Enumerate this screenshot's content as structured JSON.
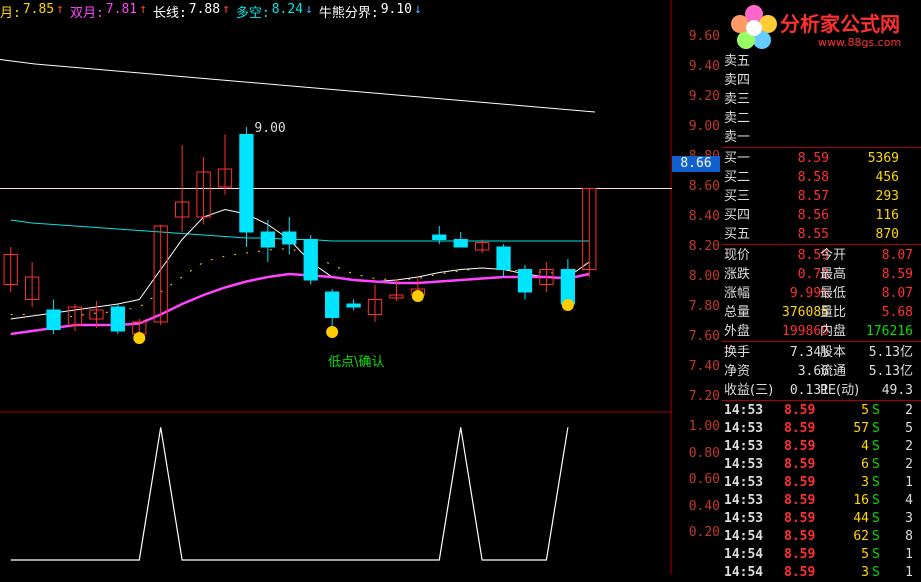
{
  "header": {
    "items": [
      {
        "label": "月:",
        "value": "7.85",
        "arrow": "↑",
        "color": "#ffd700"
      },
      {
        "label": "双月:",
        "value": "7.81",
        "arrow": "↑",
        "color": "#ff44ff"
      },
      {
        "label": "长线:",
        "value": "7.88",
        "arrow": "↑",
        "color": "#ffffff"
      },
      {
        "label": "多空:",
        "value": "8.24",
        "arrow": "↓",
        "color": "#00e5e5"
      },
      {
        "label": "牛熊分界:",
        "value": "9.10",
        "arrow": "↓",
        "color": "#ffffff"
      }
    ]
  },
  "price_marker": "8.66",
  "annotations": {
    "high_label": "9.00",
    "low_label": "低点\\确认"
  },
  "logo": {
    "title": "分析家公式网",
    "url": "www.88gs.com"
  },
  "chart_data": [
    {
      "type": "candlestick",
      "y_ticks_main": [
        "9.60",
        "9.40",
        "9.20",
        "9.00",
        "8.80",
        "8.60",
        "8.40",
        "8.20",
        "8.00",
        "7.80",
        "7.60",
        "7.40",
        "7.20"
      ],
      "ylim": [
        7.1,
        9.7
      ],
      "reference_line": 8.59,
      "candles": [
        {
          "o": 7.95,
          "h": 8.2,
          "l": 7.9,
          "c": 8.15
        },
        {
          "o": 7.85,
          "h": 8.1,
          "l": 7.8,
          "c": 8.0
        },
        {
          "o": 7.78,
          "h": 7.85,
          "l": 7.62,
          "c": 7.65
        },
        {
          "o": 7.68,
          "h": 7.82,
          "l": 7.64,
          "c": 7.8
        },
        {
          "o": 7.72,
          "h": 7.84,
          "l": 7.66,
          "c": 7.78
        },
        {
          "o": 7.8,
          "h": 7.82,
          "l": 7.62,
          "c": 7.64
        },
        {
          "o": 7.62,
          "h": 7.72,
          "l": 7.58,
          "c": 7.7
        },
        {
          "o": 7.7,
          "h": 8.35,
          "l": 7.68,
          "c": 8.34
        },
        {
          "o": 8.4,
          "h": 8.88,
          "l": 8.3,
          "c": 8.5
        },
        {
          "o": 8.4,
          "h": 8.8,
          "l": 8.35,
          "c": 8.7
        },
        {
          "o": 8.6,
          "h": 8.95,
          "l": 8.55,
          "c": 8.72
        },
        {
          "o": 8.95,
          "h": 9.0,
          "l": 8.2,
          "c": 8.3
        },
        {
          "o": 8.3,
          "h": 8.38,
          "l": 8.1,
          "c": 8.2
        },
        {
          "o": 8.3,
          "h": 8.4,
          "l": 8.15,
          "c": 8.22
        },
        {
          "o": 8.25,
          "h": 8.28,
          "l": 7.95,
          "c": 7.98
        },
        {
          "o": 7.9,
          "h": 7.92,
          "l": 7.62,
          "c": 7.73
        },
        {
          "o": 7.82,
          "h": 7.85,
          "l": 7.78,
          "c": 7.8
        },
        {
          "o": 7.75,
          "h": 7.95,
          "l": 7.7,
          "c": 7.85
        },
        {
          "o": 7.86,
          "h": 7.98,
          "l": 7.84,
          "c": 7.88
        },
        {
          "o": 7.88,
          "h": 8.0,
          "l": 7.86,
          "c": 7.92
        },
        {
          "o": 8.28,
          "h": 8.34,
          "l": 8.22,
          "c": 8.25
        },
        {
          "o": 8.25,
          "h": 8.3,
          "l": 8.2,
          "c": 8.2
        },
        {
          "o": 8.18,
          "h": 8.25,
          "l": 8.16,
          "c": 8.23
        },
        {
          "o": 8.2,
          "h": 8.22,
          "l": 8.0,
          "c": 8.05
        },
        {
          "o": 8.05,
          "h": 8.08,
          "l": 7.85,
          "c": 7.9
        },
        {
          "o": 7.95,
          "h": 8.1,
          "l": 7.9,
          "c": 8.05
        },
        {
          "o": 8.05,
          "h": 8.12,
          "l": 7.8,
          "c": 7.82
        },
        {
          "o": 8.05,
          "h": 8.59,
          "l": 8.0,
          "c": 8.59
        }
      ],
      "lines": [
        {
          "name": "牛熊分界",
          "color": "#ffffff",
          "values": [
            9.45,
            9.42,
            9.4,
            9.38,
            9.36,
            9.34,
            9.32,
            9.3,
            9.28,
            9.26,
            9.24,
            9.22,
            9.2,
            9.18,
            9.16,
            9.14,
            9.12,
            9.1
          ]
        },
        {
          "name": "多空",
          "color": "#00e5e5",
          "values": [
            8.38,
            8.36,
            8.35,
            8.34,
            8.33,
            8.32,
            8.31,
            8.3,
            8.29,
            8.28,
            8.27,
            8.26,
            8.26,
            8.25,
            8.25,
            8.24,
            8.24,
            8.24,
            8.24,
            8.24,
            8.24,
            8.24,
            8.24,
            8.24,
            8.24,
            8.24,
            8.24,
            8.24
          ]
        },
        {
          "name": "长线",
          "color": "#ffffff",
          "values": [
            7.72,
            7.74,
            7.76,
            7.78,
            7.8,
            7.82,
            7.85,
            8.05,
            8.25,
            8.4,
            8.45,
            8.42,
            8.35,
            8.25,
            8.1,
            8.0,
            7.98,
            7.97,
            7.98,
            8.0,
            8.03,
            8.05,
            8.06,
            8.05,
            8.02,
            8.0,
            8.0,
            8.1
          ]
        },
        {
          "name": "月",
          "color": "#ffd700",
          "values": [
            7.75,
            7.75,
            7.72,
            7.74,
            7.76,
            7.77,
            7.8,
            7.9,
            8.0,
            8.1,
            8.14,
            8.16,
            8.18,
            8.19,
            8.15,
            8.08,
            8.02,
            7.99,
            7.98,
            7.99,
            8.02,
            8.04,
            8.06,
            8.05,
            8.04,
            8.03,
            8.02,
            8.1
          ]
        },
        {
          "name": "双月",
          "color": "#ff44ff",
          "values": [
            7.62,
            7.64,
            7.66,
            7.68,
            7.68,
            7.68,
            7.69,
            7.75,
            7.82,
            7.88,
            7.93,
            7.97,
            8.0,
            8.02,
            8.01,
            8.0,
            7.98,
            7.97,
            7.96,
            7.96,
            7.97,
            7.98,
            7.99,
            8.0,
            8.0,
            8.0,
            7.99,
            8.02
          ]
        }
      ]
    },
    {
      "type": "line",
      "y_ticks": [
        "1.00",
        "0.80",
        "0.60",
        "0.40",
        "0.20"
      ],
      "ylim": [
        0,
        1.1
      ],
      "values": [
        0,
        0,
        0,
        0,
        0,
        0,
        0,
        1,
        0,
        0,
        0,
        0,
        0,
        0,
        0,
        0,
        0,
        0,
        0,
        0,
        0,
        1,
        0,
        0,
        0,
        0,
        1
      ]
    }
  ],
  "quote_panel": {
    "sell_rows": [
      {
        "label": "卖五"
      },
      {
        "label": "卖四"
      },
      {
        "label": "卖三"
      },
      {
        "label": "卖二"
      },
      {
        "label": "卖一"
      }
    ],
    "buy_rows": [
      {
        "label": "买一",
        "price": "8.59",
        "vol": "5369"
      },
      {
        "label": "买二",
        "price": "8.58",
        "vol": "456"
      },
      {
        "label": "买三",
        "price": "8.57",
        "vol": "293"
      },
      {
        "label": "买四",
        "price": "8.56",
        "vol": "116"
      },
      {
        "label": "买五",
        "price": "8.55",
        "vol": "870"
      }
    ],
    "stats": [
      {
        "l1": "现价",
        "v1": "8.59",
        "c1": "red",
        "l2": "今开",
        "v2": "8.07",
        "c2": "red"
      },
      {
        "l1": "涨跌",
        "v1": "0.78",
        "c1": "red",
        "l2": "最高",
        "v2": "8.59",
        "c2": "red"
      },
      {
        "l1": "涨幅",
        "v1": "9.99%",
        "c1": "red",
        "l2": "最低",
        "v2": "8.07",
        "c2": "red"
      },
      {
        "l1": "总量",
        "v1": "376085",
        "c1": "yellow",
        "l2": "量比",
        "v2": "5.68",
        "c2": "red"
      },
      {
        "l1": "外盘",
        "v1": "199869",
        "c1": "red",
        "l2": "内盘",
        "v2": "176216",
        "c2": "green"
      }
    ],
    "stats2": [
      {
        "l1": "换手",
        "v1": "7.34%",
        "l2": "股本",
        "v2": "5.13亿"
      },
      {
        "l1": "净资",
        "v1": "3.66",
        "l2": "流通",
        "v2": "5.13亿"
      },
      {
        "l1": "收益(三)",
        "v1": "0.131",
        "l2": "PE(动)",
        "v2": "49.3"
      }
    ],
    "ticks": [
      {
        "time": "14:53",
        "price": "8.59",
        "vol": "5",
        "dir": "S",
        "cnt": "2"
      },
      {
        "time": "14:53",
        "price": "8.59",
        "vol": "57",
        "dir": "S",
        "cnt": "5"
      },
      {
        "time": "14:53",
        "price": "8.59",
        "vol": "4",
        "dir": "S",
        "cnt": "2"
      },
      {
        "time": "14:53",
        "price": "8.59",
        "vol": "6",
        "dir": "S",
        "cnt": "2"
      },
      {
        "time": "14:53",
        "price": "8.59",
        "vol": "3",
        "dir": "S",
        "cnt": "1"
      },
      {
        "time": "14:53",
        "price": "8.59",
        "vol": "16",
        "dir": "S",
        "cnt": "4"
      },
      {
        "time": "14:53",
        "price": "8.59",
        "vol": "44",
        "dir": "S",
        "cnt": "3"
      },
      {
        "time": "14:54",
        "price": "8.59",
        "vol": "62",
        "dir": "S",
        "cnt": "8"
      },
      {
        "time": "14:54",
        "price": "8.59",
        "vol": "5",
        "dir": "S",
        "cnt": "1"
      },
      {
        "time": "14:54",
        "price": "8.59",
        "vol": "3",
        "dir": "S",
        "cnt": "1"
      }
    ]
  }
}
